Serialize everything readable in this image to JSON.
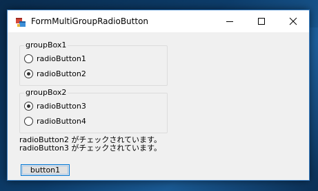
{
  "window": {
    "title": "FormMultiGroupRadioButton",
    "icon": "winforms-app-icon"
  },
  "titlebar_buttons": [
    {
      "name": "minimize",
      "icon": "minimize-icon"
    },
    {
      "name": "maximize",
      "icon": "maximize-icon"
    },
    {
      "name": "close",
      "icon": "close-icon"
    }
  ],
  "groupBox1": {
    "label": "groupBox1",
    "radios": [
      {
        "label": "radioButton1",
        "checked": false
      },
      {
        "label": "radioButton2",
        "checked": true
      }
    ]
  },
  "groupBox2": {
    "label": "groupBox2",
    "radios": [
      {
        "label": "radioButton3",
        "checked": true
      },
      {
        "label": "radioButton4",
        "checked": false
      }
    ]
  },
  "status": {
    "line1": "radioButton2 がチェックされています。",
    "line2": "radioButton3 がチェックされています。"
  },
  "button1": {
    "label": "button1"
  },
  "colors": {
    "accent": "#0078d7",
    "window_bg": "#f0f0f0",
    "titlebar_bg": "#ffffff"
  }
}
